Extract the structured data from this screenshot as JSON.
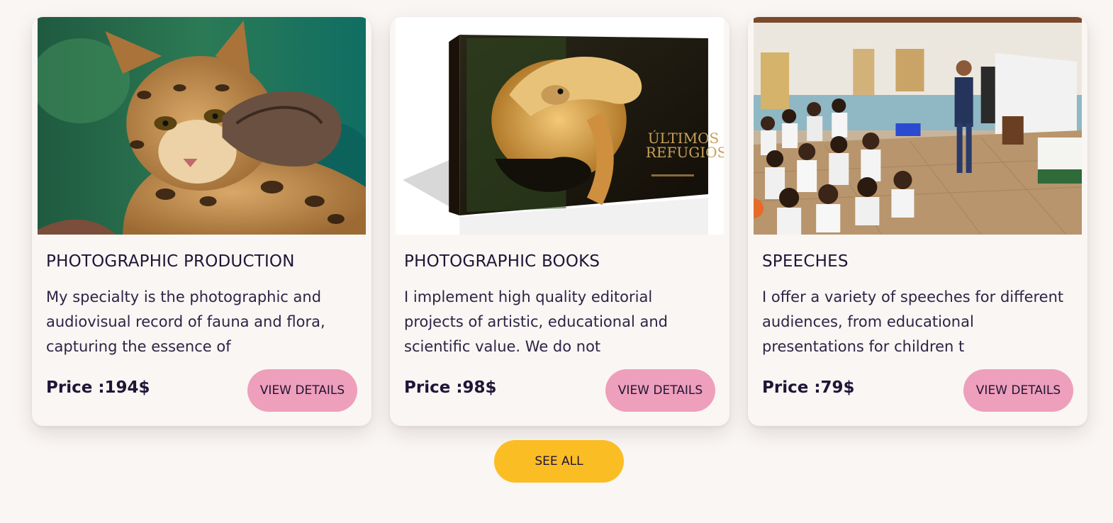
{
  "cards": [
    {
      "image_alt": "ocelot on a branch",
      "title": "PHOTOGRAPHIC PRODUCTION",
      "description": "My specialty is the photographic and audiovisual record of fauna and flora, capturing the essence of",
      "price": "Price :194$",
      "button_label": "VIEW DETAILS"
    },
    {
      "image_alt": "photo book cover with anteater",
      "title": "PHOTOGRAPHIC BOOKS",
      "description": "I implement high quality editorial projects of artistic, educational and scientific value. We do not",
      "price": "Price :98$",
      "button_label": "VIEW DETAILS",
      "book_cover_text": "ÚLTIMOS REFUGIOS"
    },
    {
      "image_alt": "speaker presenting to a classroom of children",
      "title": "SPEECHES",
      "description": "I offer a variety of speeches for different audiences, from educational presentations for children t",
      "price": "Price :79$",
      "button_label": "VIEW DETAILS"
    }
  ],
  "see_all_label": "SEE ALL",
  "colors": {
    "background": "#faf6f3",
    "text": "#1f1537",
    "details_button": "#ee9fbb",
    "see_all_button": "#fbbd24"
  }
}
